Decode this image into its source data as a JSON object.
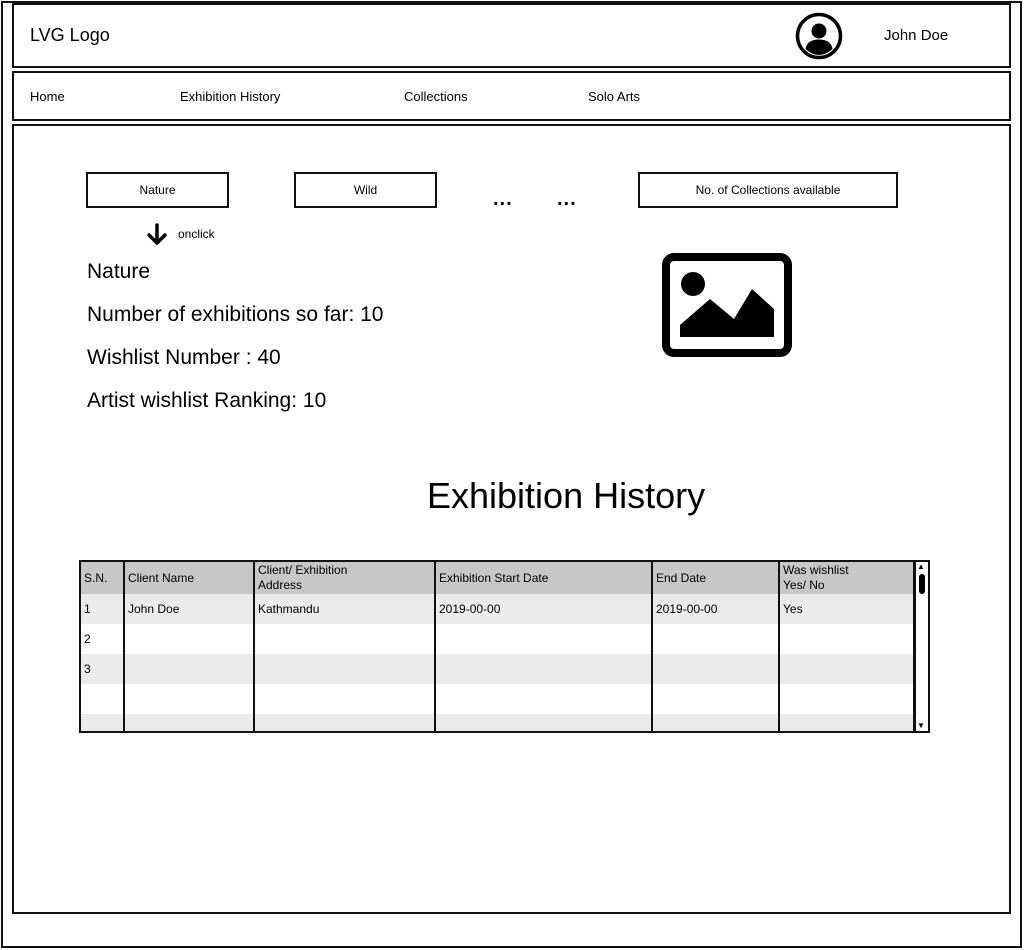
{
  "header": {
    "logo": "LVG Logo",
    "user_name": "John Doe",
    "avatar_icon": "user-avatar-icon"
  },
  "nav": {
    "items": [
      {
        "label": "Home"
      },
      {
        "label": "Exhibition History"
      },
      {
        "label": "Collections"
      },
      {
        "label": "Solo Arts"
      }
    ]
  },
  "collections": {
    "tabs": [
      {
        "label": "Nature"
      },
      {
        "label": "Wild"
      }
    ],
    "ellipsis": [
      "...",
      "..."
    ],
    "count_label": "No. of Collections available",
    "onclick_label": "onclick",
    "arrow_icon": "arrow-down-icon"
  },
  "details": {
    "name": "Nature",
    "exhibitions": "Number of exhibitions so far: 10",
    "wishlist_number": "Wishlist Number : 40",
    "wishlist_ranking": "Artist wishlist Ranking: 10",
    "image_icon": "image-placeholder-icon"
  },
  "exhibition_history": {
    "title": "Exhibition History",
    "columns": [
      "S.N.",
      "Client Name",
      "Client/ Exhibition\n Address",
      "Exhibition Start Date",
      "End Date",
      "Was wishlist\n Yes/ No"
    ],
    "rows": [
      [
        "1",
        "John Doe",
        "Kathmandu",
        "2019-00-00",
        "2019-00-00",
        "Yes"
      ],
      [
        "2",
        "",
        "",
        "",
        "",
        ""
      ],
      [
        "3",
        "",
        "",
        "",
        "",
        ""
      ],
      [
        "",
        "",
        "",
        "",
        "",
        ""
      ],
      [
        "",
        "",
        "",
        "",
        "",
        ""
      ]
    ]
  }
}
